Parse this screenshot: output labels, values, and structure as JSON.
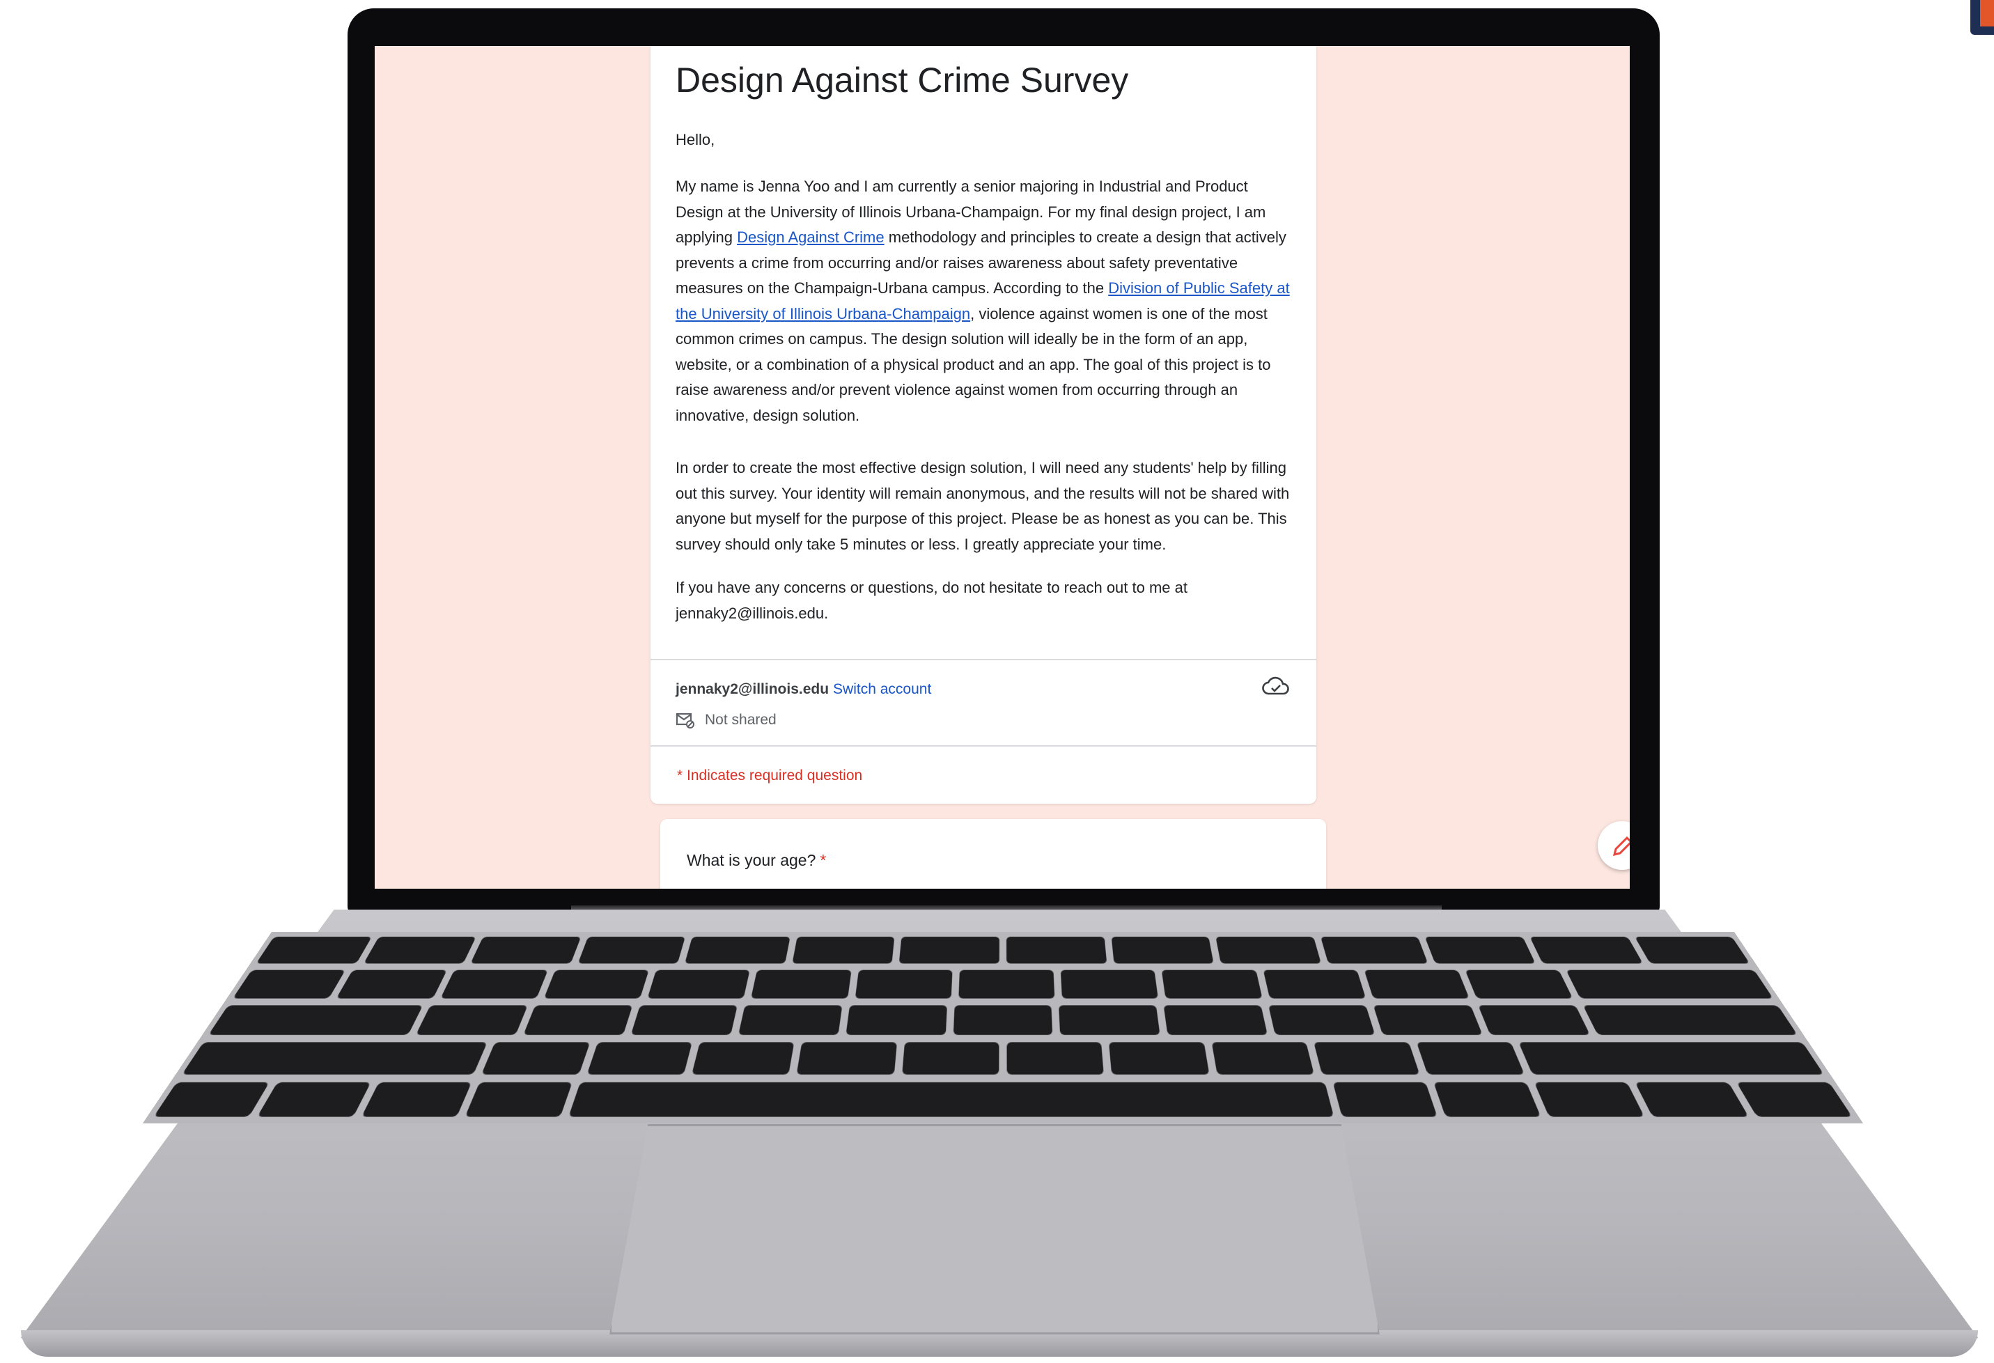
{
  "form": {
    "title": "Design Against Crime Survey",
    "greeting": "Hello,",
    "p1_a": "My name is Jenna Yoo and I am currently a senior majoring in Industrial and Product Design at the University of Illinois Urbana-Champaign. For my final design project, I am applying ",
    "p1_link1": "Design Against Crime",
    "p1_b": " methodology and principles to create a design that actively prevents a crime from occurring and/or raises awareness about safety preventative measures on the Champaign-Urbana campus. According to the ",
    "p1_link2": "Division of Public Safety at the University of Illinois Urbana-Champaign",
    "p1_c": ", violence against women is one of the most common crimes on campus. The design solution will ideally be in the form of an app, website, or a combination of a physical product and an app. The goal of this project is to raise awareness and/or prevent violence against women from occurring through an innovative, design solution.",
    "p2": "In order to create the most effective design solution, I will need any students' help by filling out this survey. Your identity will remain anonymous, and the results will not be shared with anyone but myself for the purpose of this project. Please be as honest as you can be. This survey should only take 5 minutes or less. I greatly appreciate your time.",
    "p3": "If you have any concerns or questions, do not hesitate to reach out to me at jennaky2@illinois.edu.",
    "account_email": "jennaky2@illinois.edu",
    "switch_account": "Switch account",
    "not_shared": "Not shared",
    "required_note": "* Indicates required question"
  },
  "question": {
    "text": "What is your age?",
    "required_mark": "*"
  },
  "icons": {
    "cloud": "cloud-saved-icon",
    "mail": "mail-not-shared-icon",
    "edit": "edit-pencil-icon"
  },
  "colors": {
    "screen_bg": "#fde6e0",
    "link": "#1a56c8",
    "required": "#d93025"
  }
}
